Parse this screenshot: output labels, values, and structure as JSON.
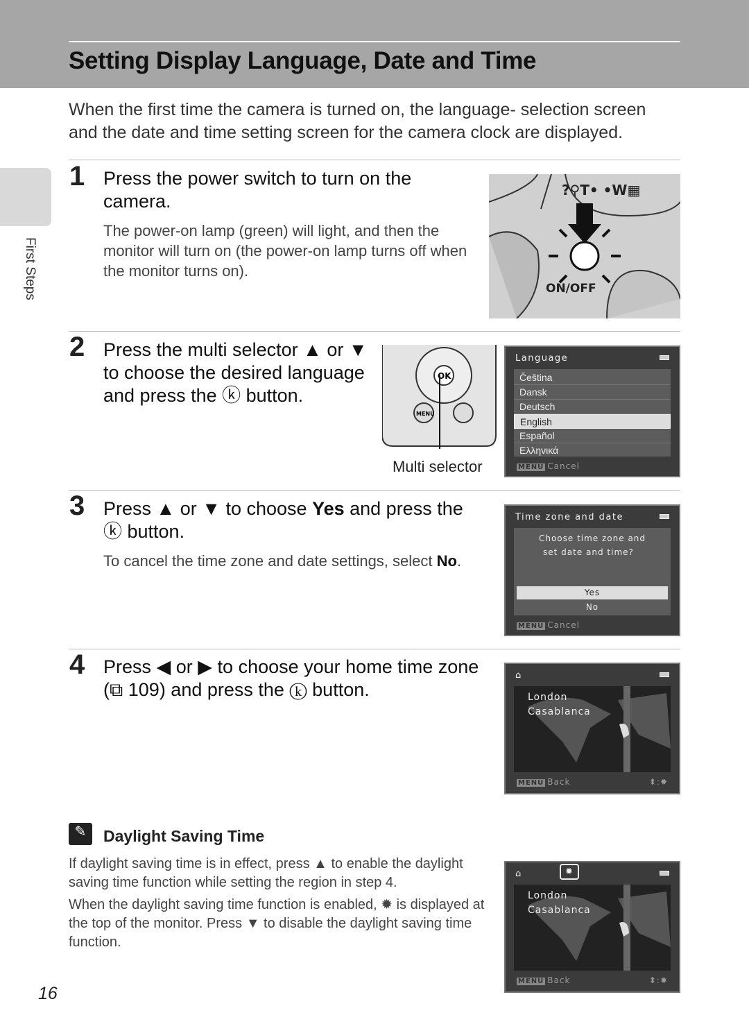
{
  "header": {
    "title": "Setting Display Language, Date and Time"
  },
  "side_tab": {
    "label": "First Steps"
  },
  "intro": "When the first time the camera is turned on, the language- selection screen and the date and time setting screen for the camera clock are displayed.",
  "steps": [
    {
      "number": "1",
      "heading": "Press the power switch to turn on the camera.",
      "body": "The power-on lamp (green) will light, and then the monitor will turn on (the power-on lamp turns off when the monitor turns on).",
      "illustration_label": "ON/OFF"
    },
    {
      "number": "2",
      "heading": "Press the multi selector ▲ or ▼ to choose the desired language and press the ⓚ button.",
      "callout": "Multi selector"
    },
    {
      "number": "3",
      "heading_parts": [
        "Press ▲ or ▼ to choose ",
        "Yes",
        " and press the ⓚ button."
      ],
      "body_parts": [
        "To cancel the time zone and date settings, select ",
        "No",
        "."
      ]
    },
    {
      "number": "4",
      "heading": "Press ◀ or ▶ to choose your home time zone (⧉ 109) and press the ⓚ button."
    }
  ],
  "screen_language": {
    "title": "Language",
    "items": [
      "Čeština",
      "Dansk",
      "Deutsch",
      "English",
      "Español",
      "Ελληνικά"
    ],
    "selected": "English",
    "menu": "MENU",
    "footer": "Cancel"
  },
  "screen_timezone": {
    "title": "Time zone and date",
    "prompt_line1": "Choose time zone and",
    "prompt_line2": "set date and time?",
    "options": [
      "Yes",
      "No"
    ],
    "selected": "Yes",
    "menu": "MENU",
    "footer": "Cancel"
  },
  "screen_map": {
    "cities": [
      "London",
      "Casablanca"
    ],
    "menu": "MENU",
    "footer": "Back"
  },
  "note": {
    "title": "Daylight Saving Time",
    "p1": "If daylight saving time is in effect, press ▲ to enable the daylight saving time function while setting the region in step 4.",
    "p2": "When the daylight saving time function is enabled, ✹ is displayed at the top of the monitor. Press ▼ to disable the daylight saving time function."
  },
  "page_number": "16"
}
